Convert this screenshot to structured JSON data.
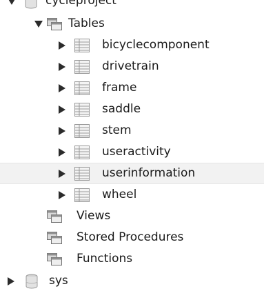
{
  "tree": {
    "schema": {
      "label": "cycleproject",
      "tables": {
        "label": "Tables",
        "items": [
          {
            "label": "bicyclecomponent"
          },
          {
            "label": "drivetrain"
          },
          {
            "label": "frame"
          },
          {
            "label": "saddle"
          },
          {
            "label": "stem"
          },
          {
            "label": "useractivity"
          },
          {
            "label": "userinformation",
            "selected": true
          },
          {
            "label": "wheel"
          }
        ]
      },
      "views": {
        "label": "Views"
      },
      "stored_procedures": {
        "label": "Stored Procedures"
      },
      "functions": {
        "label": "Functions"
      }
    },
    "sys": {
      "label": "sys"
    }
  },
  "colors": {
    "arrow": "#2b2b2b",
    "selected_row": "#f2f2f2",
    "table_icon": "#9a9a9a"
  },
  "icons": {
    "expanded": "triangle-down-icon",
    "collapsed": "triangle-right-icon",
    "folder": "folder-icon",
    "table": "table-icon",
    "database": "database-icon"
  }
}
